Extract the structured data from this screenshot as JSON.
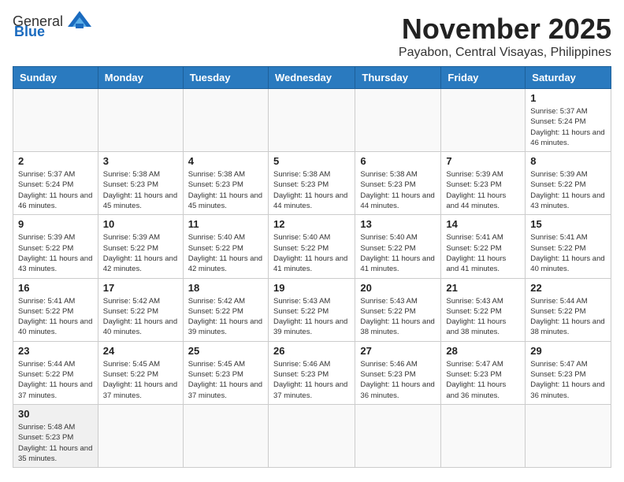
{
  "header": {
    "logo_general": "General",
    "logo_blue": "Blue",
    "month_title": "November 2025",
    "subtitle": "Payabon, Central Visayas, Philippines"
  },
  "weekdays": [
    "Sunday",
    "Monday",
    "Tuesday",
    "Wednesday",
    "Thursday",
    "Friday",
    "Saturday"
  ],
  "weeks": [
    [
      {
        "day": "",
        "info": ""
      },
      {
        "day": "",
        "info": ""
      },
      {
        "day": "",
        "info": ""
      },
      {
        "day": "",
        "info": ""
      },
      {
        "day": "",
        "info": ""
      },
      {
        "day": "",
        "info": ""
      },
      {
        "day": "1",
        "info": "Sunrise: 5:37 AM\nSunset: 5:24 PM\nDaylight: 11 hours and 46 minutes."
      }
    ],
    [
      {
        "day": "2",
        "info": "Sunrise: 5:37 AM\nSunset: 5:24 PM\nDaylight: 11 hours and 46 minutes."
      },
      {
        "day": "3",
        "info": "Sunrise: 5:38 AM\nSunset: 5:23 PM\nDaylight: 11 hours and 45 minutes."
      },
      {
        "day": "4",
        "info": "Sunrise: 5:38 AM\nSunset: 5:23 PM\nDaylight: 11 hours and 45 minutes."
      },
      {
        "day": "5",
        "info": "Sunrise: 5:38 AM\nSunset: 5:23 PM\nDaylight: 11 hours and 44 minutes."
      },
      {
        "day": "6",
        "info": "Sunrise: 5:38 AM\nSunset: 5:23 PM\nDaylight: 11 hours and 44 minutes."
      },
      {
        "day": "7",
        "info": "Sunrise: 5:39 AM\nSunset: 5:23 PM\nDaylight: 11 hours and 44 minutes."
      },
      {
        "day": "8",
        "info": "Sunrise: 5:39 AM\nSunset: 5:22 PM\nDaylight: 11 hours and 43 minutes."
      }
    ],
    [
      {
        "day": "9",
        "info": "Sunrise: 5:39 AM\nSunset: 5:22 PM\nDaylight: 11 hours and 43 minutes."
      },
      {
        "day": "10",
        "info": "Sunrise: 5:39 AM\nSunset: 5:22 PM\nDaylight: 11 hours and 42 minutes."
      },
      {
        "day": "11",
        "info": "Sunrise: 5:40 AM\nSunset: 5:22 PM\nDaylight: 11 hours and 42 minutes."
      },
      {
        "day": "12",
        "info": "Sunrise: 5:40 AM\nSunset: 5:22 PM\nDaylight: 11 hours and 41 minutes."
      },
      {
        "day": "13",
        "info": "Sunrise: 5:40 AM\nSunset: 5:22 PM\nDaylight: 11 hours and 41 minutes."
      },
      {
        "day": "14",
        "info": "Sunrise: 5:41 AM\nSunset: 5:22 PM\nDaylight: 11 hours and 41 minutes."
      },
      {
        "day": "15",
        "info": "Sunrise: 5:41 AM\nSunset: 5:22 PM\nDaylight: 11 hours and 40 minutes."
      }
    ],
    [
      {
        "day": "16",
        "info": "Sunrise: 5:41 AM\nSunset: 5:22 PM\nDaylight: 11 hours and 40 minutes."
      },
      {
        "day": "17",
        "info": "Sunrise: 5:42 AM\nSunset: 5:22 PM\nDaylight: 11 hours and 40 minutes."
      },
      {
        "day": "18",
        "info": "Sunrise: 5:42 AM\nSunset: 5:22 PM\nDaylight: 11 hours and 39 minutes."
      },
      {
        "day": "19",
        "info": "Sunrise: 5:43 AM\nSunset: 5:22 PM\nDaylight: 11 hours and 39 minutes."
      },
      {
        "day": "20",
        "info": "Sunrise: 5:43 AM\nSunset: 5:22 PM\nDaylight: 11 hours and 38 minutes."
      },
      {
        "day": "21",
        "info": "Sunrise: 5:43 AM\nSunset: 5:22 PM\nDaylight: 11 hours and 38 minutes."
      },
      {
        "day": "22",
        "info": "Sunrise: 5:44 AM\nSunset: 5:22 PM\nDaylight: 11 hours and 38 minutes."
      }
    ],
    [
      {
        "day": "23",
        "info": "Sunrise: 5:44 AM\nSunset: 5:22 PM\nDaylight: 11 hours and 37 minutes."
      },
      {
        "day": "24",
        "info": "Sunrise: 5:45 AM\nSunset: 5:22 PM\nDaylight: 11 hours and 37 minutes."
      },
      {
        "day": "25",
        "info": "Sunrise: 5:45 AM\nSunset: 5:23 PM\nDaylight: 11 hours and 37 minutes."
      },
      {
        "day": "26",
        "info": "Sunrise: 5:46 AM\nSunset: 5:23 PM\nDaylight: 11 hours and 37 minutes."
      },
      {
        "day": "27",
        "info": "Sunrise: 5:46 AM\nSunset: 5:23 PM\nDaylight: 11 hours and 36 minutes."
      },
      {
        "day": "28",
        "info": "Sunrise: 5:47 AM\nSunset: 5:23 PM\nDaylight: 11 hours and 36 minutes."
      },
      {
        "day": "29",
        "info": "Sunrise: 5:47 AM\nSunset: 5:23 PM\nDaylight: 11 hours and 36 minutes."
      }
    ],
    [
      {
        "day": "30",
        "info": "Sunrise: 5:48 AM\nSunset: 5:23 PM\nDaylight: 11 hours and 35 minutes."
      },
      {
        "day": "",
        "info": ""
      },
      {
        "day": "",
        "info": ""
      },
      {
        "day": "",
        "info": ""
      },
      {
        "day": "",
        "info": ""
      },
      {
        "day": "",
        "info": ""
      },
      {
        "day": "",
        "info": ""
      }
    ]
  ]
}
